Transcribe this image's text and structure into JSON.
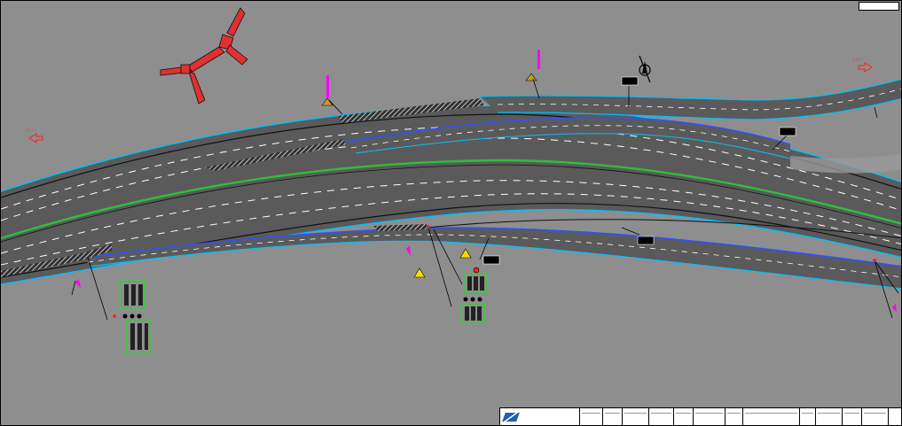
{
  "drawing": {
    "title_badge": "",
    "notes": {
      "heading": "",
      "lines": [
        "",
        ""
      ]
    },
    "signs": {
      "sign1": "",
      "sign2": "",
      "sign3": "",
      "sign4": "",
      "sign5": ""
    },
    "title_block": {
      "company_line1": "",
      "company_line2": "",
      "cells": [
        [
          "",
          ""
        ],
        [
          "",
          ""
        ],
        [
          "",
          ""
        ],
        [
          "",
          ""
        ],
        [
          "",
          ""
        ],
        [
          "",
          ""
        ],
        [
          "",
          ""
        ],
        [
          "",
          ""
        ],
        [
          "",
          ""
        ],
        [
          "",
          ""
        ],
        [
          "",
          ""
        ],
        [
          "",
          ""
        ]
      ],
      "sheet": ""
    }
  },
  "colors": {
    "background": "#8e8e8e",
    "pavement": "#5a5a5a",
    "edge_line": "#00c0ff",
    "lane_marking": "#ffffff",
    "median_line": "#2fbf3a",
    "ramp_line": "#3050ff",
    "magenta_text": "#ff00ff",
    "red_arrow": "#ff2020",
    "signal_box": "#22dd22",
    "warning_sign": "#ffd800"
  },
  "icons": [
    "north-arrow-icon",
    "direction-arrow-icon",
    "warning-triangle-icon",
    "traffic-signal-icon"
  ]
}
